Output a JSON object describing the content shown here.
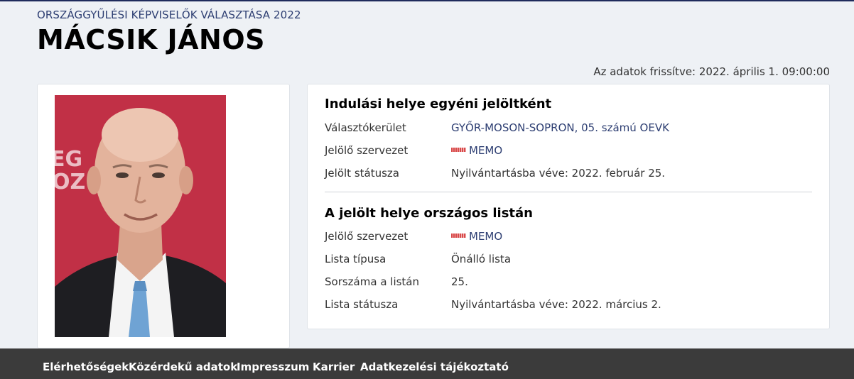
{
  "header": {
    "election_title": "ORSZÁGGYŰLÉSI KÉPVISELŐK VÁLASZTÁSA 2022",
    "candidate_name": "MÁCSIK JÁNOS",
    "updated": "Az adatok frissítve: 2022. április 1. 09:00:00"
  },
  "photo": {
    "backdrop_text": "EG OZ"
  },
  "individual": {
    "title": "Indulási helye egyéni jelöltként",
    "rows": [
      {
        "label": "Választókerület",
        "value": "GYŐR-MOSON-SOPRON, 05. számú OEVK"
      },
      {
        "label": "Jelölő szervezet",
        "value": "MEMO"
      },
      {
        "label": "Jelölt státusza",
        "value": "Nyilvántartásba véve: 2022. február 25."
      }
    ]
  },
  "national_list": {
    "title": "A jelölt helye országos listán",
    "rows": [
      {
        "label": "Jelölő szervezet",
        "value": "MEMO"
      },
      {
        "label": "Lista típusa",
        "value": "Önálló lista"
      },
      {
        "label": "Sorszáma a listán",
        "value": "25."
      },
      {
        "label": "Lista státusza",
        "value": "Nyilvántartásba véve: 2022. március 2."
      }
    ]
  },
  "footer": {
    "links": [
      "Elérhetőségek",
      "Közérdekű adatok",
      "Impresszum",
      "Karrier",
      "Adatkezelési tájékoztató"
    ]
  },
  "colors": {
    "accent": "#2d3e72",
    "backdrop_red": "#c9344a",
    "footer_bg": "#3b3b3b"
  }
}
